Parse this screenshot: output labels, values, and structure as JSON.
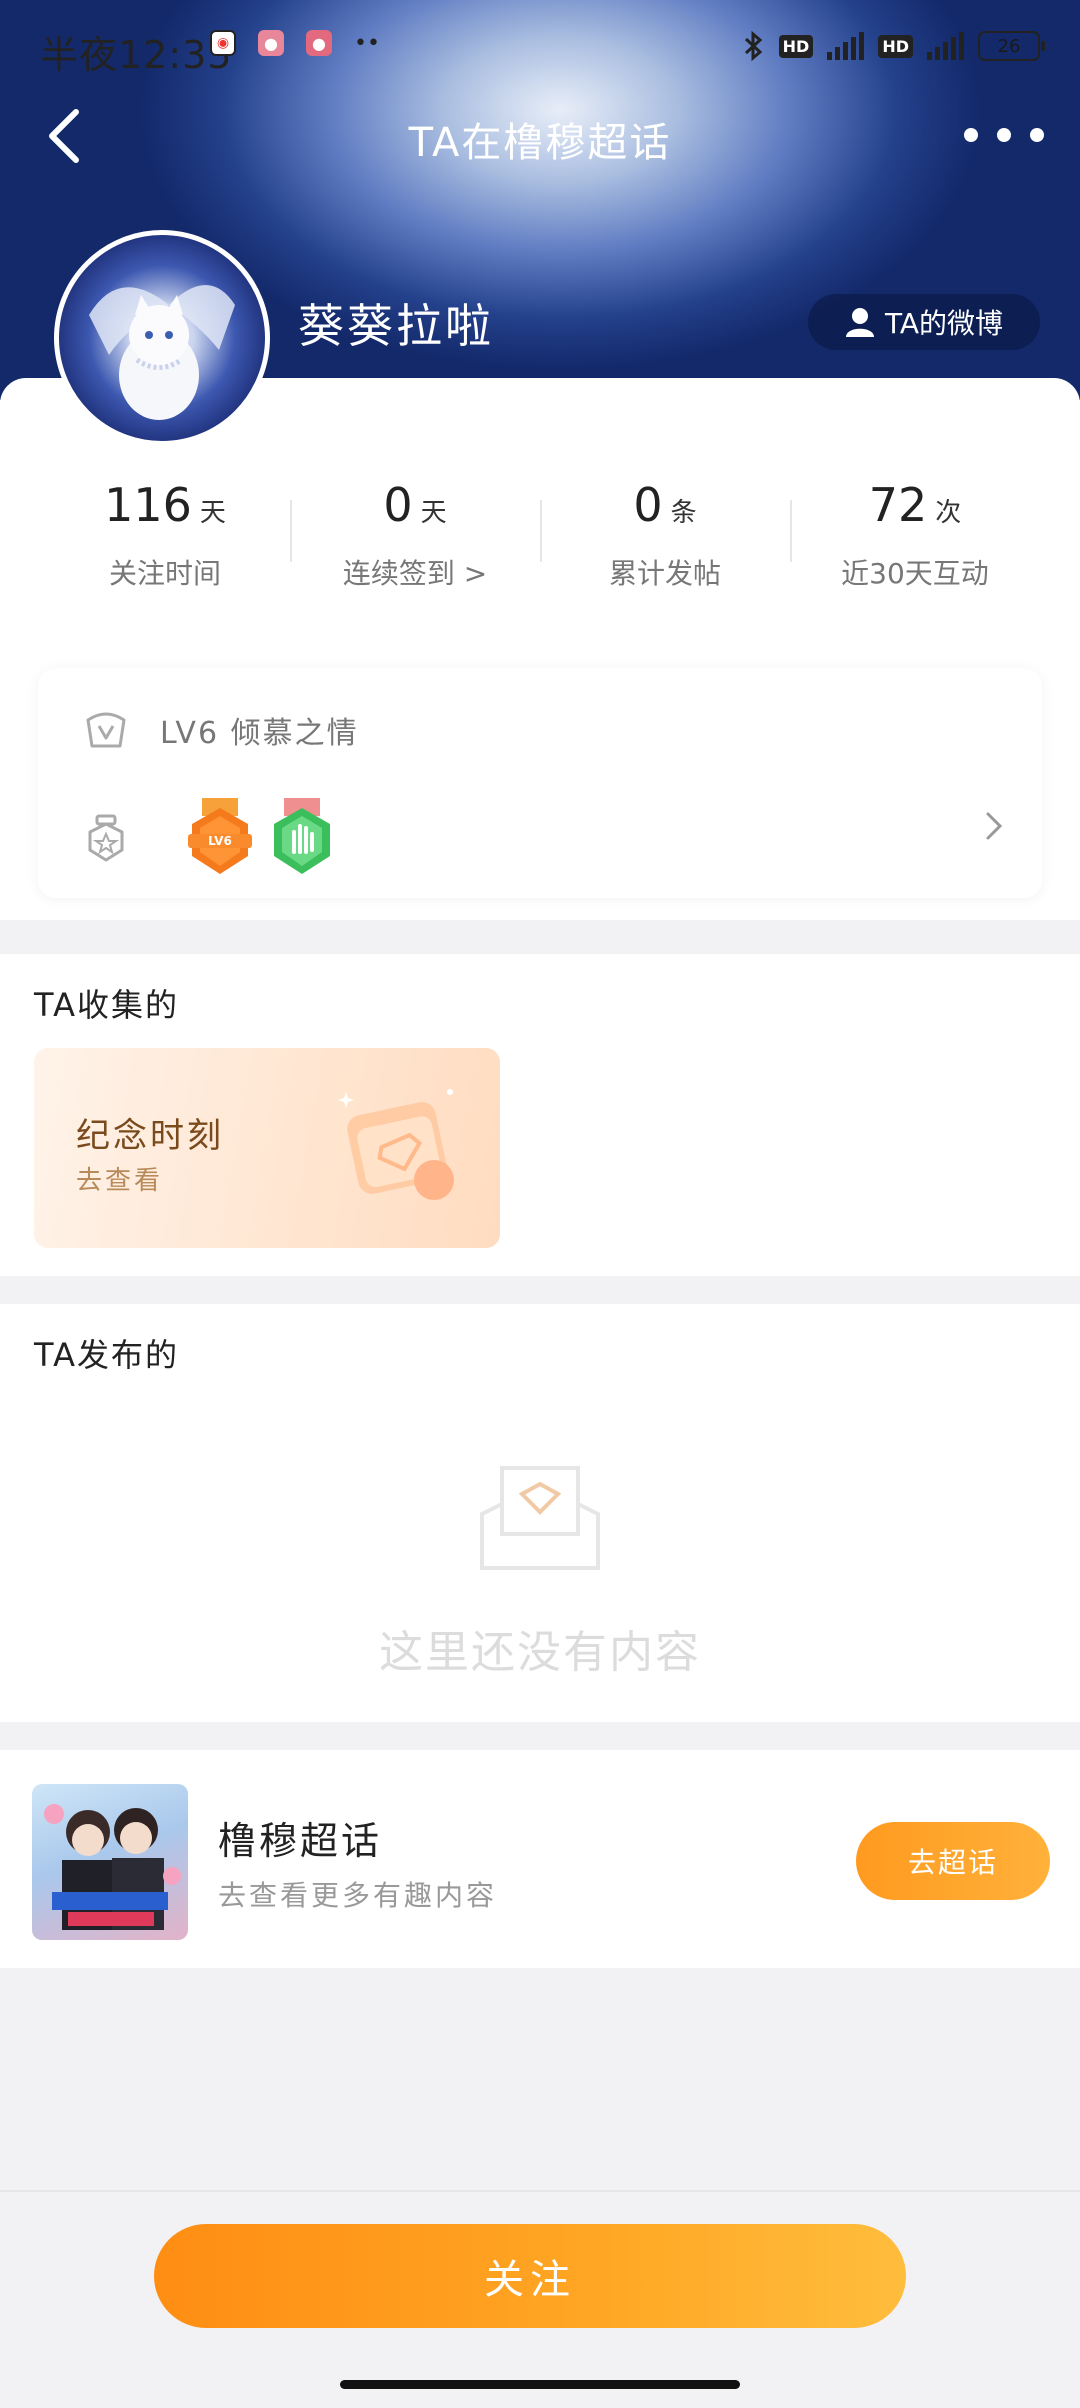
{
  "status_bar": {
    "time": "半夜12:35",
    "battery": "26",
    "sim1": "HD",
    "sim2": "HD"
  },
  "nav": {
    "title": "TA在橹穆超话"
  },
  "profile": {
    "username": "葵葵拉啦",
    "weibo_button": "TA的微博"
  },
  "stats": [
    {
      "value": "116",
      "unit": "天",
      "label": "关注时间"
    },
    {
      "value": "0",
      "unit": "天",
      "label": "连续签到 >"
    },
    {
      "value": "0",
      "unit": "条",
      "label": "累计发帖"
    },
    {
      "value": "72",
      "unit": "次",
      "label": "近30天互动"
    }
  ],
  "level": {
    "text": "LV6 倾慕之情",
    "badge1": "LV6"
  },
  "collected": {
    "title": "TA收集的",
    "card_title": "纪念时刻",
    "card_sub": "去查看"
  },
  "published": {
    "title": "TA发布的",
    "empty_text": "这里还没有内容"
  },
  "topic": {
    "name": "橹穆超话",
    "sub": "去查看更多有趣内容",
    "button": "去超话"
  },
  "follow_button": "关注",
  "colors": {
    "accent": "#ff9a1f",
    "header_dark": "#13296a"
  }
}
